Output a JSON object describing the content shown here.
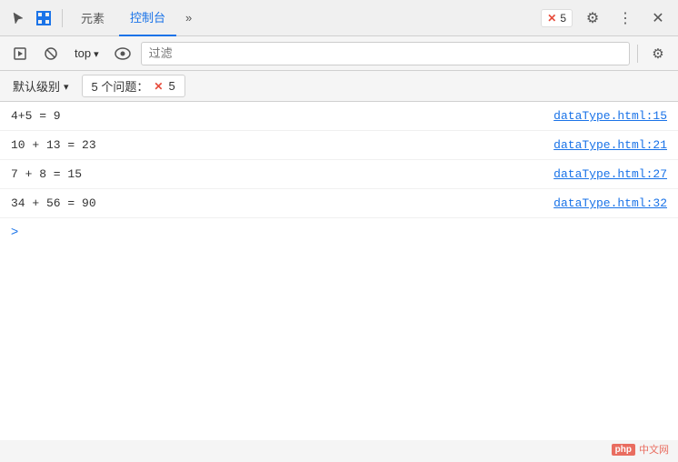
{
  "tabs": {
    "elements": "元素",
    "console": "控制台",
    "more": "»"
  },
  "tabBar": {
    "errorCount": "5",
    "icons": {
      "cursor": "⬛",
      "inspect": "🔲",
      "gear": "⚙",
      "dots": "⋮",
      "close": "✕"
    }
  },
  "toolbar2": {
    "playBtn": "▶",
    "blockBtn": "🚫",
    "topLabel": "top",
    "eyeBtn": "👁",
    "filterPlaceholder": "过滤",
    "settingsBtn": "⚙"
  },
  "issuesBar": {
    "levelLabel": "默认级别",
    "issuesLabel": "5 个问题：",
    "errorCount": "5"
  },
  "consoleRows": [
    {
      "text": "4+5 = 9",
      "link": "dataType.html:15"
    },
    {
      "text": "10 + 13 = 23",
      "link": "dataType.html:21"
    },
    {
      "text": "7 + 8 = 15",
      "link": "dataType.html:27"
    },
    {
      "text": "34 + 56 = 90",
      "link": "dataType.html:32"
    }
  ],
  "prompt": ">",
  "watermark": {
    "badge": "php",
    "text": "中文网"
  }
}
